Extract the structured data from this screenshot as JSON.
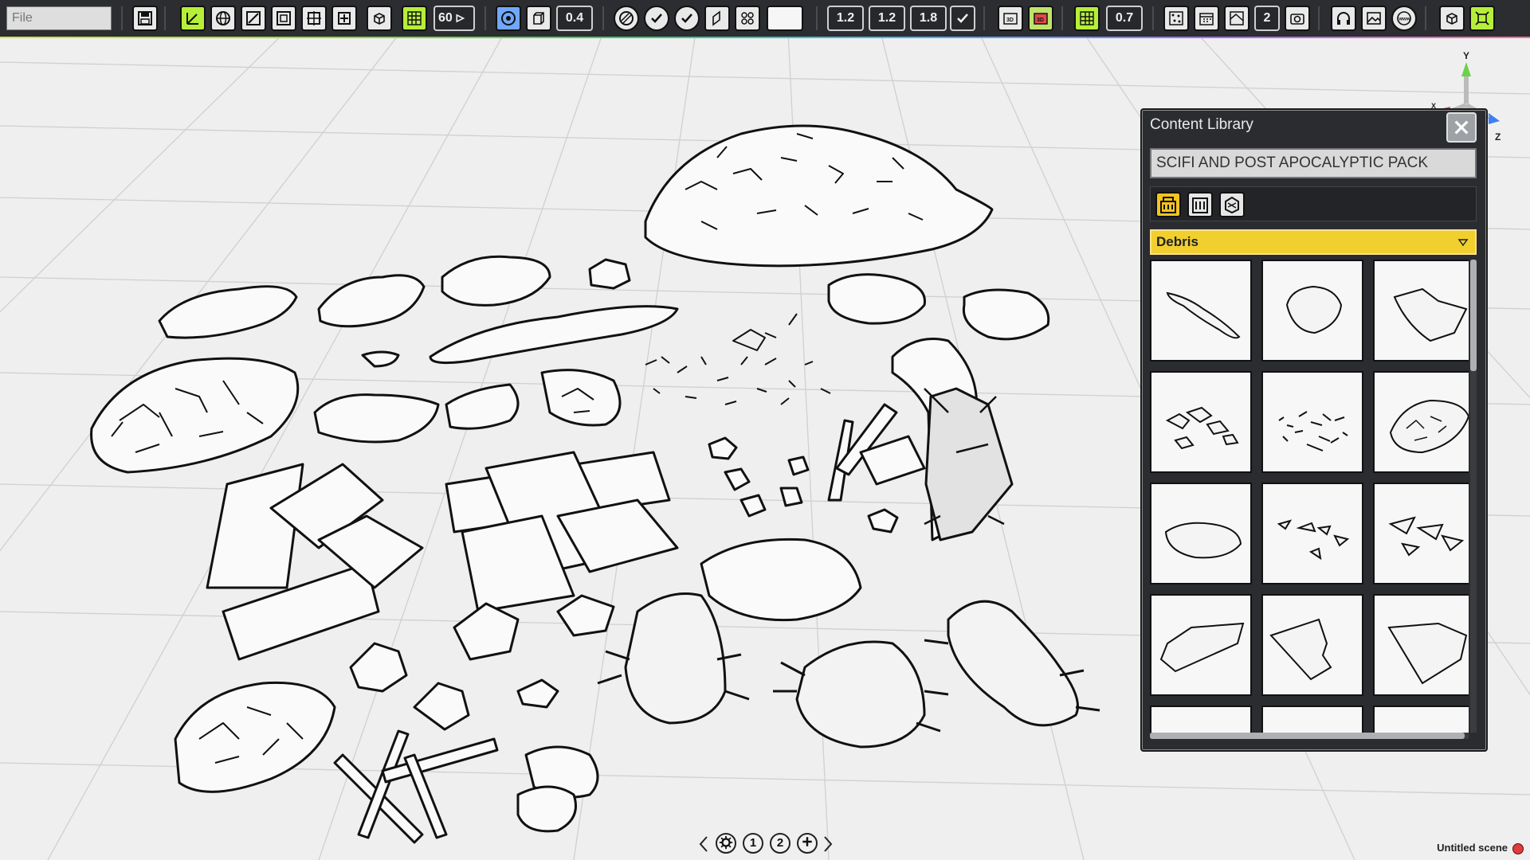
{
  "toolbar": {
    "file_placeholder": "File",
    "fov_value": "60",
    "outline_value": "0.4",
    "setting_a": "1.2",
    "setting_b": "1.2",
    "setting_c": "1.8",
    "opacity_value": "0.7",
    "page_count_value": "2",
    "icons": [
      "save-icon",
      "axis-icon",
      "globe-icon",
      "scale-icon",
      "frame-icon",
      "transform-icon",
      "group-icon",
      "cube-icon",
      "grid-icon",
      "camera-fov-icon",
      "target-icon",
      "box-icon",
      "hatch-icon",
      "check-dotted-icon",
      "check-icon",
      "extrude-icon",
      "pattern-icon",
      "color-swatch-icon",
      "check-box-icon",
      "view-3d-icon",
      "view-3d-color-icon",
      "grid-display-icon",
      "opacity-icon",
      "noise-icon",
      "calendar-icon",
      "material-icon",
      "pages-icon",
      "camera-icon",
      "headphones-icon",
      "image-icon",
      "web-icon",
      "rotate-cube-icon",
      "fit-icon"
    ]
  },
  "gizmo": {
    "y_label": "Y",
    "z_label": "Z",
    "x_label": "X"
  },
  "content_library": {
    "title": "Content Library",
    "pack_name": "SCIFI AND POST APOCALYPTIC PACK",
    "category": "Debris",
    "mode_icons": [
      "models-3d-icon",
      "buildings-icon",
      "materials-icon"
    ],
    "thumbnails": [
      "pipe-debris-icon",
      "rock-icon",
      "rock-slab-icon",
      "rubble-scatter-icon",
      "debris-bits-icon",
      "rubble-pile-icon",
      "flat-rock-icon",
      "shards-icon",
      "glass-shards-icon",
      "plank-icon",
      "plate-icon",
      "slab-corner-icon",
      "partial-tile-a",
      "partial-tile-b",
      "partial-tile-c"
    ]
  },
  "pager": {
    "page1": "1",
    "page2": "2"
  },
  "status": {
    "scene_name": "Untitled scene",
    "unsaved_color": "#e23b3b"
  },
  "colors": {
    "toolbar_bg": "#2b2d30",
    "accent_green": "#b6ef3a",
    "category_yellow": "#f1cf2f"
  }
}
